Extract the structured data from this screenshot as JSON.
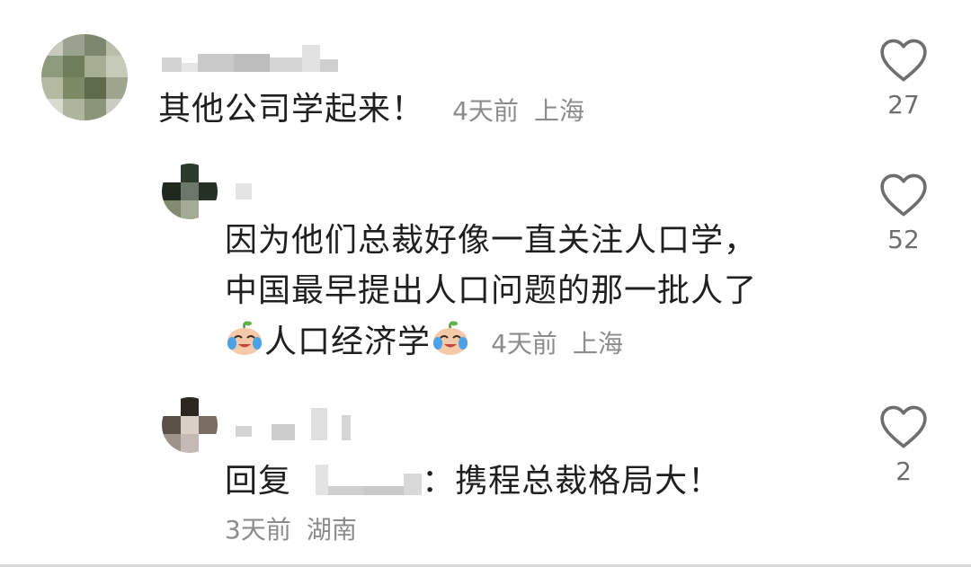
{
  "comments": [
    {
      "text": "其他公司学起来！",
      "time": "4天前",
      "location": "上海",
      "likes": "27"
    },
    {
      "text_line1": "因为他们总裁好像一直关注人口学，",
      "text_line2": "中国最早提出人口问题的那一批人了",
      "text_line3": "人口经济学",
      "time": "4天前",
      "location": "上海",
      "likes": "52"
    },
    {
      "reply_prefix": "回复",
      "reply_colon": "：",
      "text": "携程总裁格局大！",
      "time": "3天前",
      "location": "湖南",
      "likes": "2"
    }
  ],
  "icons": {
    "like": "heart-outline-icon",
    "emoji": "crying-laughing-emoji"
  },
  "colors": {
    "text": "#1f1f1f",
    "meta": "#8c8c8c",
    "icon": "#6e6e6e"
  }
}
